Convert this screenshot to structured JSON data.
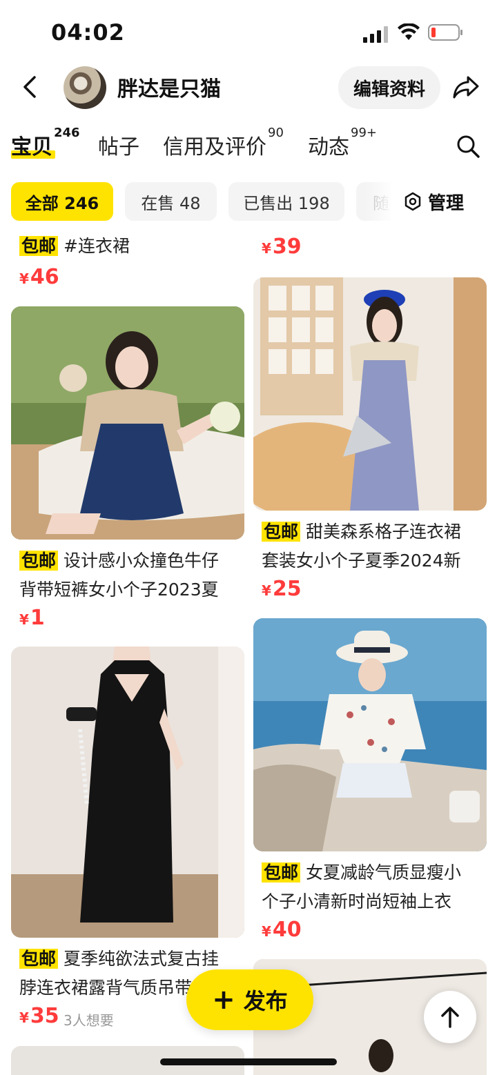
{
  "status_bar": {
    "time": "04:02"
  },
  "header": {
    "username": "胖达是只猫",
    "edit_label": "编辑资料"
  },
  "tabs": [
    {
      "label": "宝贝",
      "count": "246"
    },
    {
      "label": "帖子",
      "count": ""
    },
    {
      "label": "信用及评价",
      "count": "90"
    },
    {
      "label": "动态",
      "count": "99+"
    }
  ],
  "filters": [
    {
      "label": "全部 246"
    },
    {
      "label": "在售 48"
    },
    {
      "label": "已售出 198"
    },
    {
      "label": "随"
    }
  ],
  "manage_label": "管理",
  "currency": "¥",
  "free_shipping": "包邮",
  "items": [
    {
      "title_line1": "#连衣裙",
      "title_line2": "",
      "price": "46"
    },
    {
      "title_line1": "",
      "title_line2": "",
      "price": "39"
    },
    {
      "title_line1": "设计感小众撞色牛仔",
      "title_line2": "背带短裤女小个子2023夏",
      "price": "1"
    },
    {
      "title_line1": "甜美森系格子连衣裙",
      "title_line2": "套装女小个子夏季2024新",
      "price": "25"
    },
    {
      "title_line1": "夏季纯欲法式复古挂",
      "title_line2": "脖连衣裙露背气质吊带",
      "price": "35",
      "wants": "3人想要"
    },
    {
      "title_line1": "女夏减龄气质显瘦小",
      "title_line2": "个子小清新时尚短袖上衣",
      "price": "40"
    }
  ],
  "publish_label": "发布",
  "colors": {
    "accent": "#ffe300",
    "price": "#ff3b3b"
  }
}
